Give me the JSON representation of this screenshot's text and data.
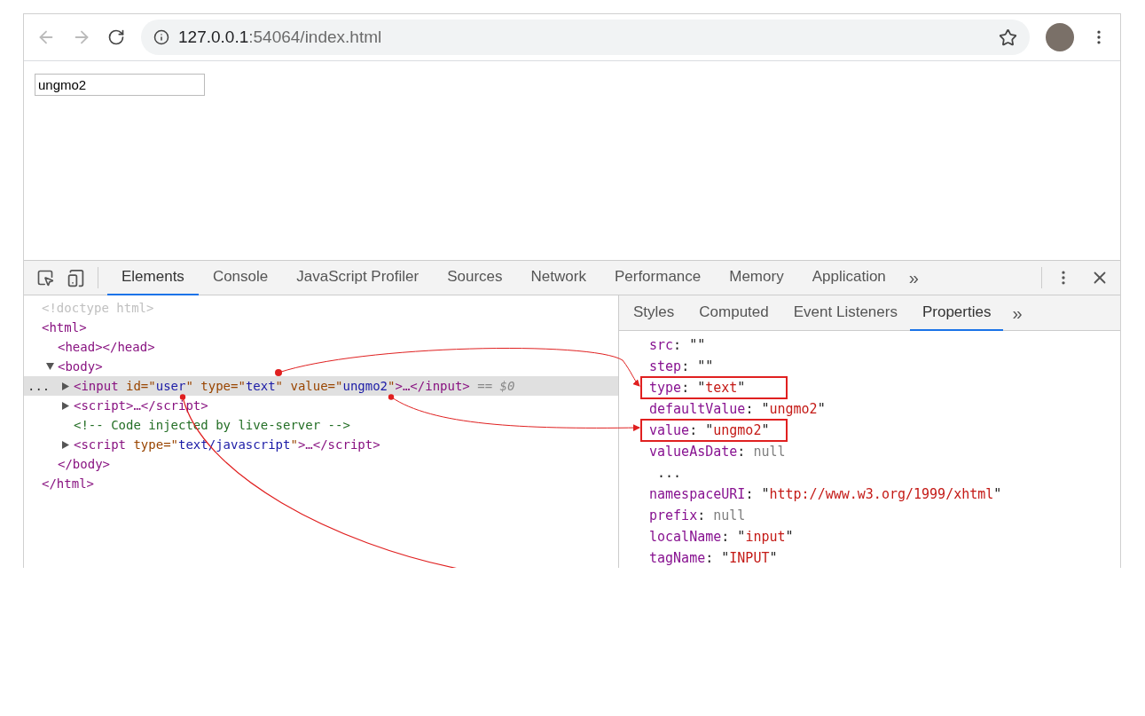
{
  "browser": {
    "url_host": "127.0.0.1",
    "url_path": ":54064/index.html",
    "back_disabled": true,
    "forward_disabled": true
  },
  "page": {
    "input_value": "ungmo2"
  },
  "devtools": {
    "tabs": [
      {
        "label": "Elements",
        "selected": true
      },
      {
        "label": "Console",
        "selected": false
      },
      {
        "label": "JavaScript Profiler",
        "selected": false
      },
      {
        "label": "Sources",
        "selected": false
      },
      {
        "label": "Network",
        "selected": false
      },
      {
        "label": "Performance",
        "selected": false
      },
      {
        "label": "Memory",
        "selected": false
      },
      {
        "label": "Application",
        "selected": false
      }
    ],
    "more_tabs": "»",
    "dom_tree": [
      {
        "selected": false,
        "tokens": [
          {
            "kind": "doctype",
            "text": "<!doctype html>"
          }
        ]
      },
      {
        "selected": false,
        "tokens": [
          {
            "kind": "tag",
            "text": "<html>"
          }
        ],
        "closing": [
          {
            "kind": "tag",
            "text": "</html>"
          }
        ],
        "children": [
          {
            "selected": false,
            "tokens": [
              {
                "kind": "tag",
                "text": "<head></head>"
              }
            ]
          },
          {
            "selected": false,
            "expanded": true,
            "tokens": [
              {
                "kind": "tag",
                "text": "<body>"
              }
            ],
            "closing": [
              {
                "kind": "tag",
                "text": "</body>"
              }
            ],
            "children": [
              {
                "selected": true,
                "expanded": false,
                "gutter": "...",
                "tokens": [
                  {
                    "kind": "tag",
                    "text": "<input "
                  },
                  {
                    "kind": "attr",
                    "text": "id=\""
                  },
                  {
                    "kind": "value",
                    "text": "user"
                  },
                  {
                    "kind": "attr",
                    "text": "\" type=\""
                  },
                  {
                    "kind": "value",
                    "text": "text"
                  },
                  {
                    "kind": "attr",
                    "text": "\" value=\""
                  },
                  {
                    "kind": "value",
                    "text": "ungmo2"
                  },
                  {
                    "kind": "attr",
                    "text": "\""
                  },
                  {
                    "kind": "tag",
                    "text": ">…</input>"
                  },
                  {
                    "kind": "marker",
                    "text": " == $0"
                  }
                ]
              },
              {
                "selected": false,
                "expanded": false,
                "tokens": [
                  {
                    "kind": "tag",
                    "text": "<script>…</script>"
                  }
                ]
              },
              {
                "selected": false,
                "tokens": [
                  {
                    "kind": "comment",
                    "text": "<!-- Code injected by live-server -->"
                  }
                ]
              },
              {
                "selected": false,
                "expanded": false,
                "tokens": [
                  {
                    "kind": "tag",
                    "text": "<script "
                  },
                  {
                    "kind": "attr",
                    "text": "type=\""
                  },
                  {
                    "kind": "value",
                    "text": "text/javascript"
                  },
                  {
                    "kind": "attr",
                    "text": "\""
                  },
                  {
                    "kind": "tag",
                    "text": ">…</script>"
                  }
                ]
              }
            ]
          }
        ]
      }
    ],
    "side_tabs": [
      {
        "label": "Styles",
        "selected": false
      },
      {
        "label": "Computed",
        "selected": false
      },
      {
        "label": "Event Listeners",
        "selected": false
      },
      {
        "label": "Properties",
        "selected": true
      }
    ],
    "more_side_tabs": "»",
    "properties": [
      {
        "highlighted": false,
        "tokens": [
          {
            "kind": "key",
            "text": "src"
          },
          {
            "kind": "punct",
            "text": ": \"\""
          }
        ]
      },
      {
        "highlighted": false,
        "tokens": [
          {
            "kind": "key",
            "text": "step"
          },
          {
            "kind": "punct",
            "text": ": \"\""
          }
        ]
      },
      {
        "highlighted": true,
        "tokens": [
          {
            "kind": "key",
            "text": "type"
          },
          {
            "kind": "punct",
            "text": ": \""
          },
          {
            "kind": "string",
            "text": "text"
          },
          {
            "kind": "punct",
            "text": "\""
          }
        ]
      },
      {
        "highlighted": false,
        "tokens": [
          {
            "kind": "key",
            "text": "defaultValue"
          },
          {
            "kind": "punct",
            "text": ": \""
          },
          {
            "kind": "string",
            "text": "ungmo2"
          },
          {
            "kind": "punct",
            "text": "\""
          }
        ]
      },
      {
        "highlighted": true,
        "tokens": [
          {
            "kind": "key",
            "text": "value"
          },
          {
            "kind": "punct",
            "text": ": \""
          },
          {
            "kind": "string",
            "text": "ungmo2"
          },
          {
            "kind": "punct",
            "text": "\""
          }
        ]
      },
      {
        "highlighted": false,
        "tokens": [
          {
            "kind": "key",
            "text": "valueAsDate"
          },
          {
            "kind": "punct",
            "text": ": "
          },
          {
            "kind": "null",
            "text": "null"
          }
        ]
      },
      {
        "highlighted": false,
        "tokens": [
          {
            "kind": "punct",
            "text": " ..."
          }
        ]
      },
      {
        "highlighted": false,
        "tokens": [
          {
            "kind": "key",
            "text": "namespaceURI"
          },
          {
            "kind": "punct",
            "text": ": \""
          },
          {
            "kind": "string",
            "text": "http://www.w3.org/1999/xhtml"
          },
          {
            "kind": "punct",
            "text": "\""
          }
        ]
      },
      {
        "highlighted": false,
        "tokens": [
          {
            "kind": "key",
            "text": "prefix"
          },
          {
            "kind": "punct",
            "text": ": "
          },
          {
            "kind": "null",
            "text": "null"
          }
        ]
      },
      {
        "highlighted": false,
        "tokens": [
          {
            "kind": "key",
            "text": "localName"
          },
          {
            "kind": "punct",
            "text": ": \""
          },
          {
            "kind": "string",
            "text": "input"
          },
          {
            "kind": "punct",
            "text": "\""
          }
        ]
      },
      {
        "highlighted": false,
        "tokens": [
          {
            "kind": "key",
            "text": "tagName"
          },
          {
            "kind": "punct",
            "text": ": \""
          },
          {
            "kind": "string",
            "text": "INPUT"
          },
          {
            "kind": "punct",
            "text": "\""
          }
        ]
      }
    ]
  }
}
